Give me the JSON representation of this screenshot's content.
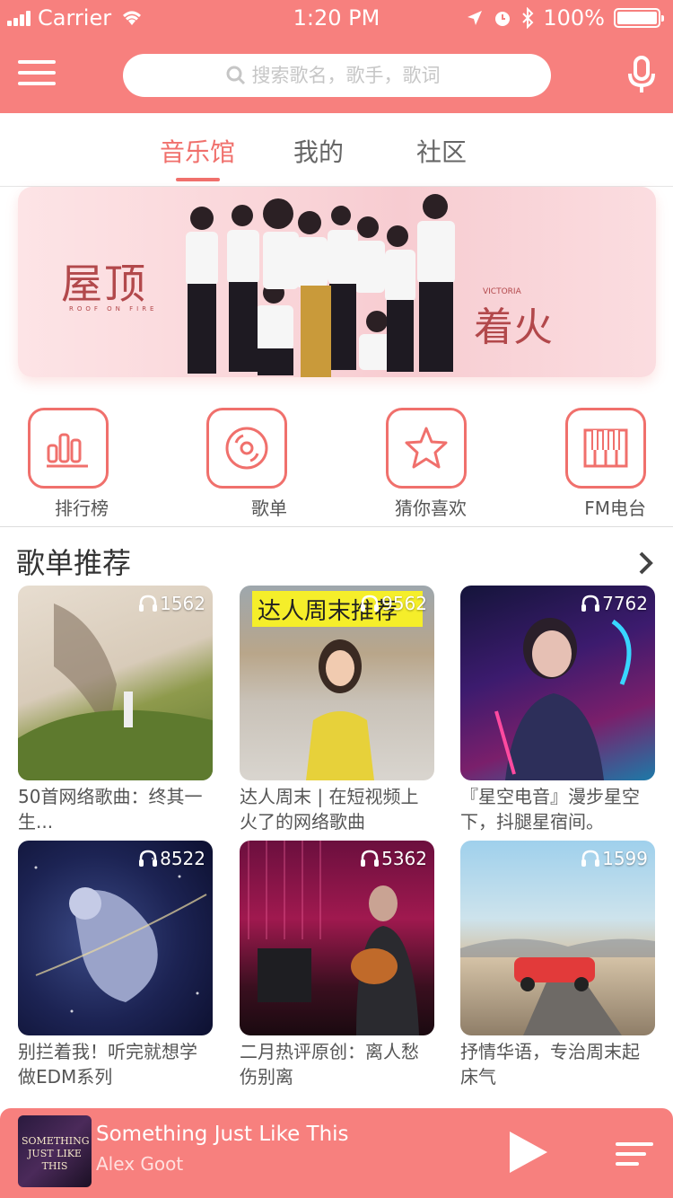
{
  "status_bar": {
    "carrier": "Carrier",
    "time": "1:20 PM",
    "battery": "100%"
  },
  "search": {
    "placeholder": "搜索歌名，歌手，歌词"
  },
  "tabs": [
    {
      "label": "音乐馆",
      "active": true
    },
    {
      "label": "我的",
      "active": false
    },
    {
      "label": "社区",
      "active": false
    }
  ],
  "banner": {
    "title_left": "屋顶",
    "subtitle_left": "ROOF   ON   FIRE",
    "brand": "VICTORIA",
    "title_right": "着火"
  },
  "quick_links": [
    {
      "label": "排行榜",
      "icon": "chart-icon"
    },
    {
      "label": "歌单",
      "icon": "disc-icon"
    },
    {
      "label": "猜你喜欢",
      "icon": "star-icon"
    },
    {
      "label": "FM电台",
      "icon": "radio-icon"
    }
  ],
  "section": {
    "title": "歌单推荐"
  },
  "playlists": [
    {
      "count": "1562",
      "title": "50首网络歌曲：终其一生..."
    },
    {
      "count": "9562",
      "title": "达人周末 | 在短视频上火了的网络歌曲",
      "overlay": "达人周末推荐"
    },
    {
      "count": "7762",
      "title": "『星空电音』漫步星空下，抖腿星宿间。"
    },
    {
      "count": "8522",
      "title": "别拦着我！听完就想学做EDM系列"
    },
    {
      "count": "5362",
      "title": "二月热评原创：离人愁伤别离"
    },
    {
      "count": "1599",
      "title": "抒情华语，专治周末起床气"
    }
  ],
  "player": {
    "cover_text": "SOMETHING JUST LIKE THIS",
    "song": "Something Just Like This",
    "artist": "Alex Goot"
  },
  "colors": {
    "accent": "#f0706c",
    "header": "#f7807e"
  }
}
